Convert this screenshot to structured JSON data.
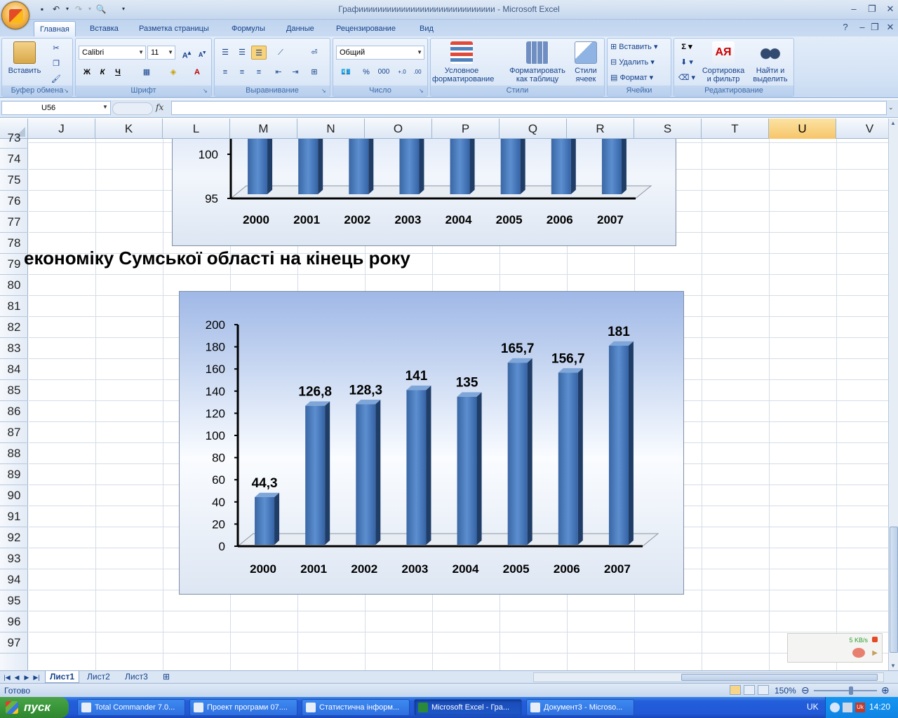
{
  "window": {
    "title": "Графиииииииииииииииииииииииииииии - Microsoft Excel"
  },
  "ribbon": {
    "tabs": [
      "Главная",
      "Вставка",
      "Разметка страницы",
      "Формулы",
      "Данные",
      "Рецензирование",
      "Вид"
    ],
    "clipboard": {
      "paste": "Вставить",
      "label": "Буфер обмена"
    },
    "font": {
      "name": "Calibri",
      "size": "11",
      "bold": "Ж",
      "italic": "К",
      "underline": "Ч",
      "label": "Шрифт"
    },
    "alignment": {
      "label": "Выравнивание"
    },
    "number": {
      "format": "Общий",
      "percent": "%",
      "thousands": "000",
      "label": "Число"
    },
    "styles": {
      "conditional_1": "Условное",
      "conditional_2": "форматирование",
      "table_1": "Форматировать",
      "table_2": "как таблицу",
      "cell_1": "Стили",
      "cell_2": "ячеек",
      "label": "Стили"
    },
    "cells": {
      "insert": "Вставить",
      "delete": "Удалить",
      "format": "Формат",
      "label": "Ячейки"
    },
    "editing": {
      "sigma": "Σ",
      "sort_1": "Сортировка",
      "sort_2": "и фильтр",
      "find_1": "Найти и",
      "find_2": "выделить",
      "label": "Редактирование"
    }
  },
  "formula_bar": {
    "name_box": "U56",
    "fx": "fx",
    "value": ""
  },
  "columns": [
    "J",
    "K",
    "L",
    "M",
    "N",
    "O",
    "P",
    "Q",
    "R",
    "S",
    "T",
    "U",
    "V"
  ],
  "selected_column": "U",
  "rows": [
    "73",
    "74",
    "75",
    "76",
    "77",
    "78",
    "79",
    "80",
    "81",
    "82",
    "83",
    "84",
    "85",
    "86",
    "87",
    "88",
    "89",
    "90",
    "91",
    "92",
    "93",
    "94",
    "95",
    "96",
    "97"
  ],
  "sheet_heading": "економіку Сумської області на кінець року",
  "chart_data": [
    {
      "type": "bar",
      "categories": [
        "2000",
        "2001",
        "2002",
        "2003",
        "2004",
        "2005",
        "2006",
        "2007"
      ],
      "visible_yticks": [
        "100",
        "95"
      ],
      "ylim": [
        95,
        100
      ],
      "title": "",
      "xlabel": "",
      "ylabel": ""
    },
    {
      "type": "bar",
      "categories": [
        "2000",
        "2001",
        "2002",
        "2003",
        "2004",
        "2005",
        "2006",
        "2007"
      ],
      "values": [
        44.3,
        126.8,
        128.3,
        141,
        135,
        165.7,
        156.7,
        181
      ],
      "data_labels": [
        "44,3",
        "126,8",
        "128,3",
        "141",
        "135",
        "165,7",
        "156,7",
        "181"
      ],
      "yticks": [
        "0",
        "20",
        "40",
        "60",
        "80",
        "100",
        "120",
        "140",
        "160",
        "180",
        "200"
      ],
      "ylim": [
        0,
        200
      ],
      "bar_color": "#4f81bd",
      "title": "",
      "xlabel": "",
      "ylabel": ""
    }
  ],
  "sheets": {
    "tabs": [
      "Лист1",
      "Лист2",
      "Лист3"
    ],
    "active": "Лист1"
  },
  "status": {
    "text": "Готово",
    "zoom": "150%"
  },
  "netmeter": {
    "speed": "5 KB/s"
  },
  "taskbar": {
    "start": "пуск",
    "tasks": [
      "Total Commander 7.0...",
      "Проект програми 07....",
      "Статистична інформ...",
      "Microsoft Excel - Гра...",
      "Документ3 - Microso..."
    ],
    "active_task": "Microsoft Excel - Гра...",
    "lang": "UK",
    "clock": "14:20"
  }
}
